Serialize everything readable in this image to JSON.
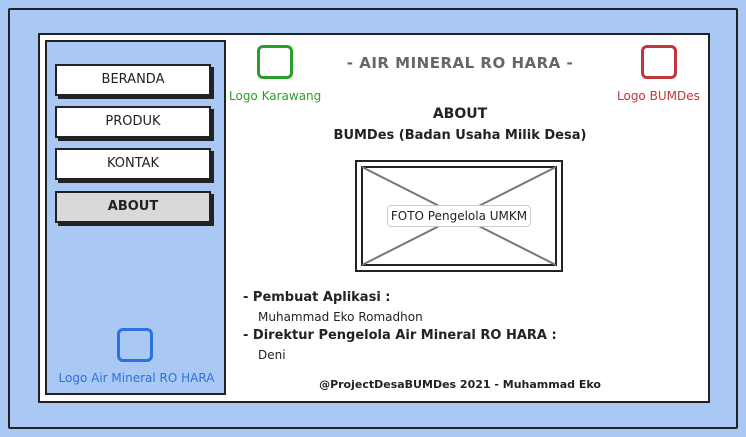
{
  "sidebar": {
    "items": [
      {
        "label": "BERANDA"
      },
      {
        "label": "PRODUK"
      },
      {
        "label": "KONTAK"
      },
      {
        "label": "ABOUT"
      }
    ],
    "logo_label": "Logo Air Mineral RO HARA"
  },
  "header": {
    "title": "- AIR MINERAL RO HARA -",
    "logo_left_label": "Logo Karawang",
    "logo_right_label": "Logo BUMDes"
  },
  "main": {
    "heading": "ABOUT",
    "subheading": "BUMDes (Badan Usaha Milik Desa)",
    "photo_label": "FOTO Pengelola UMKM",
    "creator_heading": "- Pembuat Aplikasi :",
    "creator_name": "Muhammad Eko Romadhon",
    "director_heading": "- Direktur Pengelola Air Mineral RO HARA :",
    "director_name": "Deni"
  },
  "footer": {
    "text": "@ProjectDesaBUMDes 2021 - Muhammad Eko"
  },
  "colors": {
    "background": "#a9c8f4",
    "accent_blue": "#2a72e0",
    "accent_green": "#2aa02a",
    "accent_red": "#c0363a"
  }
}
